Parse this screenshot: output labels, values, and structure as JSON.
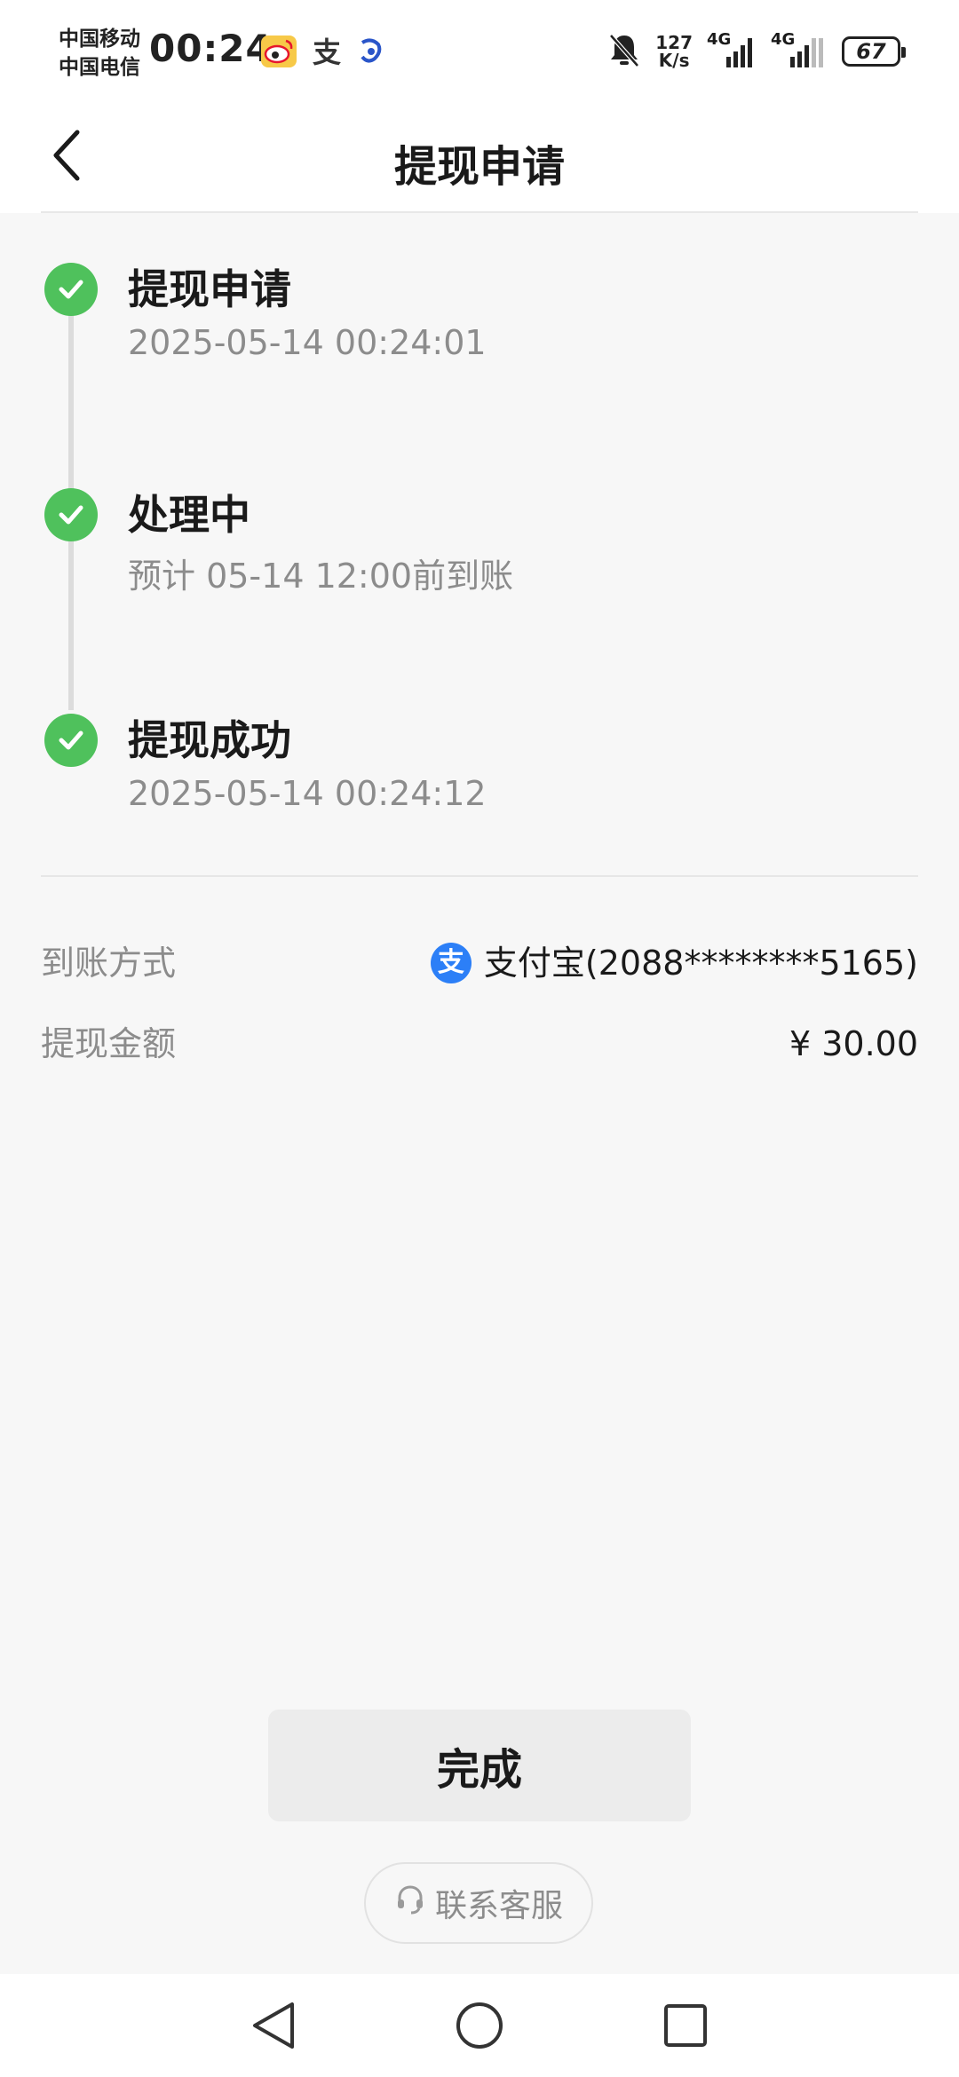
{
  "status_bar": {
    "carrier_1": "中国移动",
    "carrier_2": "中国电信",
    "time": "00:24",
    "net_speed_value": "127",
    "net_speed_unit": "K/s",
    "signal_1_label": "4G",
    "signal_2_label": "4G",
    "battery": "67",
    "app_icons": [
      "weibo-icon",
      "alipay-icon",
      "baidu-icon"
    ]
  },
  "header": {
    "title": "提现申请",
    "back_icon": "chevron-left-icon"
  },
  "timeline": {
    "accent_color": "#4fc15c",
    "steps": [
      {
        "title": "提现申请",
        "subtitle": "2025-05-14 00:24:01",
        "status": "done"
      },
      {
        "title": "处理中",
        "subtitle": "预计 05-14 12:00前到账",
        "status": "done"
      },
      {
        "title": "提现成功",
        "subtitle": "2025-05-14 00:24:12",
        "status": "done"
      }
    ]
  },
  "details": {
    "method_label": "到账方式",
    "method_icon_char": "支",
    "method_value": "支付宝(2088********5165)",
    "amount_label": "提现金额",
    "amount_value": "¥ 30.00"
  },
  "actions": {
    "done_label": "完成",
    "service_label": "联系客服"
  },
  "colors": {
    "alipay_blue": "#2c7ff7",
    "secondary_text": "#8c8c8c"
  }
}
